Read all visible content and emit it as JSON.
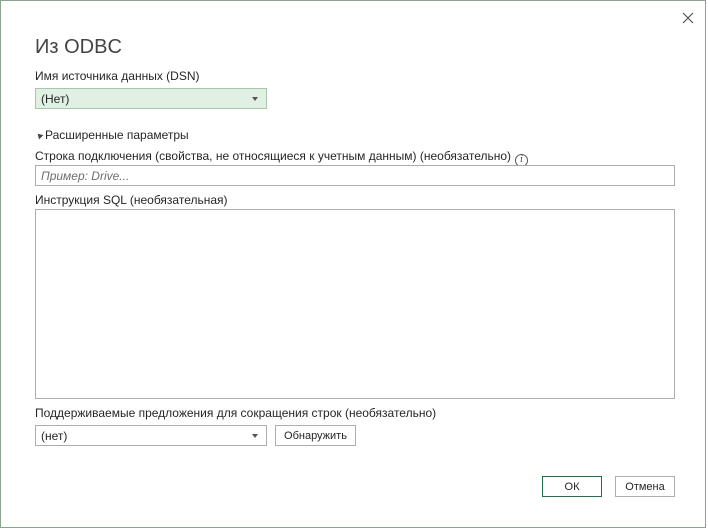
{
  "dialog": {
    "title": "Из ODBC"
  },
  "dsn": {
    "label": "Имя источника данных (DSN)",
    "selected": "(Нет)"
  },
  "advanced": {
    "label": "Расширенные параметры"
  },
  "connection_string": {
    "label": "Строка подключения (свойства, не относящиеся к учетным данным) (необязательно)",
    "placeholder": "Пример: Drive...",
    "value": ""
  },
  "sql": {
    "label": "Инструкция SQL (необязательная)",
    "value": ""
  },
  "row_reduction": {
    "label": "Поддерживаемые предложения для сокращения строк (необязательно)",
    "selected": "(нет)",
    "detect_label": "Обнаружить"
  },
  "footer": {
    "ok_label": "ОК",
    "cancel_label": "Отмена"
  },
  "icons": {
    "close": "close-icon",
    "info": "info-icon",
    "dropdown": "chevron-down-icon",
    "expander": "collapse-triangle-icon"
  }
}
